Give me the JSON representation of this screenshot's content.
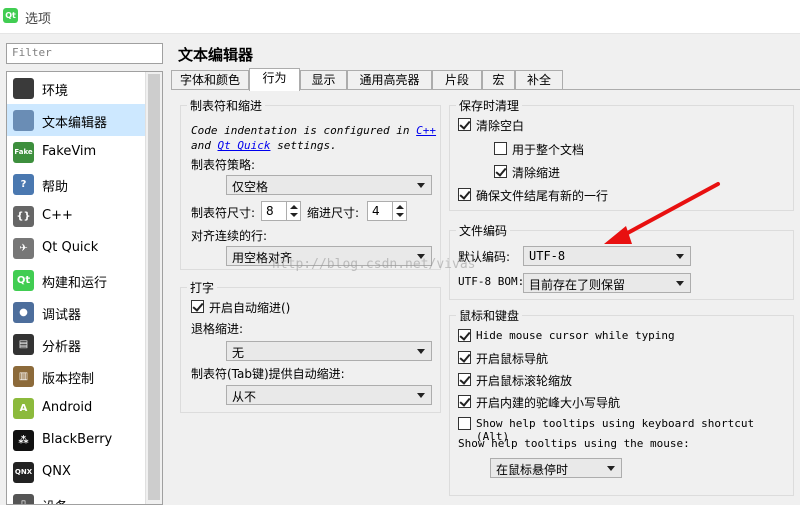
{
  "window": {
    "title": "选项",
    "app_icon": "Qt"
  },
  "filter": {
    "placeholder": "Filter"
  },
  "categories": [
    {
      "label": "环境",
      "icon": "monitor-icon",
      "color": "#3a3a3a",
      "glyph": ""
    },
    {
      "label": "文本编辑器",
      "icon": "text-editor-icon",
      "color": "#6a8db5",
      "glyph": ""
    },
    {
      "label": "FakeVim",
      "icon": "fakevim-icon",
      "color": "#3d8f3d",
      "glyph": "Fake"
    },
    {
      "label": "帮助",
      "icon": "help-icon",
      "color": "#4a78b0",
      "glyph": "?"
    },
    {
      "label": "C++",
      "icon": "cpp-braces-icon",
      "color": "#666666",
      "glyph": "{}"
    },
    {
      "label": "Qt Quick",
      "icon": "qt-quick-icon",
      "color": "#777777",
      "glyph": "✈"
    },
    {
      "label": "构建和运行",
      "icon": "build-run-icon",
      "color": "#41cd52",
      "glyph": "Qt"
    },
    {
      "label": "调试器",
      "icon": "debugger-icon",
      "color": "#4d6e9c",
      "glyph": "●"
    },
    {
      "label": "分析器",
      "icon": "analyzer-icon",
      "color": "#333333",
      "glyph": "▤"
    },
    {
      "label": "版本控制",
      "icon": "version-control-icon",
      "color": "#8c6a3a",
      "glyph": "▥"
    },
    {
      "label": "Android",
      "icon": "android-icon",
      "color": "#8cba3c",
      "glyph": "A"
    },
    {
      "label": "BlackBerry",
      "icon": "blackberry-icon",
      "color": "#111111",
      "glyph": "⁂"
    },
    {
      "label": "QNX",
      "icon": "qnx-icon",
      "color": "#222222",
      "glyph": "QNX"
    },
    {
      "label": "设备",
      "icon": "device-icon",
      "color": "#555555",
      "glyph": "▯"
    }
  ],
  "page_title": "文本编辑器",
  "tabs": [
    "字体和颜色",
    "行为",
    "显示",
    "通用高亮器",
    "片段",
    "宏",
    "补全"
  ],
  "tabs_and_indent": {
    "title": "制表符和缩进",
    "desc_line1_pre": "Code indentation is configured in ",
    "desc_link1": "C++",
    "desc_line2_pre": "and ",
    "desc_link2": "Qt Quick",
    "desc_line2_post": " settings.",
    "tab_policy_label": "制表符策略:",
    "tab_policy_value": "仅空格",
    "tab_size_label": "制表符尺寸:",
    "tab_size_value": "8",
    "indent_size_label": "缩进尺寸:",
    "indent_size_value": "4",
    "align_label": "对齐连续的行:",
    "align_value": "用空格对齐"
  },
  "typing": {
    "title": "打字",
    "auto_indent_label": "开启自动缩进()",
    "auto_indent_checked": true,
    "backspace_label": "退格缩进:",
    "backspace_value": "无",
    "tab_key_label": "制表符(Tab键)提供自动缩进:",
    "tab_key_value": "从不"
  },
  "cleanup": {
    "title": "保存时清理",
    "clean_ws_label": "清除空白",
    "clean_ws_checked": true,
    "whole_doc_label": "用于整个文档",
    "whole_doc_checked": false,
    "clean_indent_label": "清除缩进",
    "clean_indent_checked": true,
    "newline_label": "确保文件结尾有新的一行",
    "newline_checked": true
  },
  "encoding": {
    "title": "文件编码",
    "default_label": "默认编码:",
    "default_value": "UTF-8",
    "bom_label": "UTF-8 BOM:",
    "bom_value": "目前存在了则保留"
  },
  "mouse_keyboard": {
    "title": "鼠标和键盘",
    "hide_cursor_label": "Hide mouse cursor while typing",
    "hide_cursor_checked": true,
    "mouse_nav_label": "开启鼠标导航",
    "mouse_nav_checked": true,
    "wheel_zoom_label": "开启鼠标滚轮缩放",
    "wheel_zoom_checked": true,
    "camel_nav_label": "开启内建的驼峰大小写导航",
    "camel_nav_checked": true,
    "kb_tooltips_label": "Show help tooltips using keyboard shortcut (Alt)",
    "kb_tooltips_checked": false,
    "mouse_tooltips_label": "Show help tooltips using the mouse:",
    "mouse_tooltips_value": "在鼠标悬停时"
  },
  "watermark": "http://blog.csdn.net/vivas",
  "annotation": {
    "arrow_color": "#e81010"
  }
}
